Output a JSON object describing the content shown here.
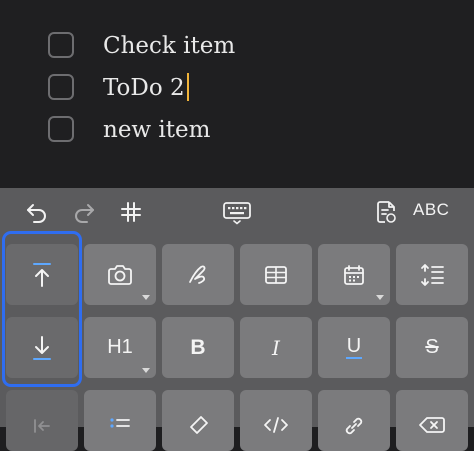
{
  "todo_list": {
    "items": [
      {
        "text": "Check item",
        "checked": false
      },
      {
        "text": "ToDo 2",
        "checked": false
      },
      {
        "text": "new item",
        "checked": false
      }
    ]
  },
  "toolbar": {
    "icons": [
      "undo-icon",
      "redo-icon",
      "hashtag-icon",
      "keyboard-icon",
      "note-link-icon"
    ],
    "abc_label": "ABC"
  },
  "keyboard": {
    "row1": [
      "move-up-icon",
      "camera-icon",
      "sketch-icon",
      "table-icon",
      "calendar-icon",
      "line-spacing-icon"
    ],
    "row2_labels": {
      "heading": "H1",
      "bold": "B",
      "italic": "I",
      "underline": "U",
      "strikethrough": "S"
    },
    "row3": [
      "indent-icon",
      "bulleted-list-icon",
      "highlighter-icon",
      "code-icon",
      "link-icon",
      "delete-icon"
    ]
  },
  "colors": {
    "accent": "#2f6df0",
    "caret": "#f1b43a",
    "underline_accent": "#5ea8ff"
  }
}
